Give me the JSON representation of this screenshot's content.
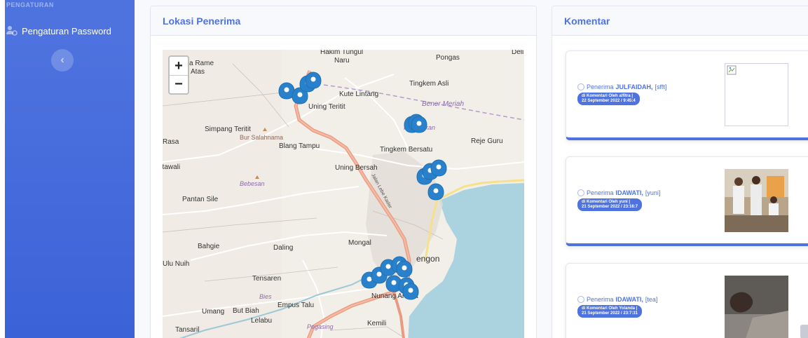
{
  "sidebar": {
    "heading": "PENGATURAN",
    "item_label": "Pengaturan Password",
    "item_icon": "user-cog-icon",
    "toggle_icon": "chevron-left-icon"
  },
  "map_card": {
    "title": "Lokasi Penerima",
    "zoom_in": "+",
    "zoom_out": "−",
    "places": {
      "hakim": "Hakim Tungul",
      "naru": "Naru",
      "pongas": "Pongas",
      "deli": "Deli",
      "rame": "a Rame",
      "atas": "Atas",
      "tingkem_asli": "Tingkem Asli",
      "kute_lintang": "Kute Lintang",
      "uning_teritit": "Uning Teritit",
      "bener_meriah": "Bener Meriah",
      "kebayakan": "Kebayakan",
      "simpang_teritit": "Simpang Teritit",
      "bur_salahnama": "Bur Salahnama",
      "rasa": "Rasa",
      "blang_tampu": "Blang Tampu",
      "tingkem_bersatu": "Tingkem Bersatu",
      "reje_guru": "Reje Guru",
      "atawali": "atawali",
      "uning_bersah": "Uning Bersah",
      "bebesan": "Bebesan",
      "jalan_lebe": "Jalan Lebe Kader",
      "pantan_sile": "Pantan Sile",
      "bahgie": "Bahgie",
      "daling": "Daling",
      "mongal": "Mongal",
      "ulu_nuih": "Ulu Nuih",
      "tengon": "engon",
      "tensaren": "Tensaren",
      "bies": "Bies",
      "nunang_antara": "Nunang Antara",
      "empus_talu": "Empus Talu",
      "umang": "Umang",
      "but_biah": "But Biah",
      "lelabu": "Lelabu",
      "pegasing": "Pegasing",
      "kemili": "Kemili",
      "tansaril": "Tansaril"
    }
  },
  "comment_card": {
    "title": "Komentar",
    "items": [
      {
        "prefix": "Penerima",
        "name": "JULFAIDAH,",
        "tag": "[sfft]",
        "badge_line1": "di Komentari Oleh alfitra |",
        "badge_line2": "22 September 2022 / 9:45:4",
        "thumb": "broken-image-icon"
      },
      {
        "prefix": "Penerima",
        "name": "IDAWATI,",
        "tag": "[yuni]",
        "badge_line1": "di Komentari Oleh yuni |",
        "badge_line2": "21 September 2022 / 23:16:7",
        "thumb": "photo-people-icon"
      },
      {
        "prefix": "Penerima",
        "name": "IDAWATI,",
        "tag": "[tea]",
        "badge_line1": "di Komentari Oleh Yolanda |",
        "badge_line2": "21 September 2022 / 23:7:31",
        "thumb": "photo-hand-icon"
      }
    ]
  }
}
